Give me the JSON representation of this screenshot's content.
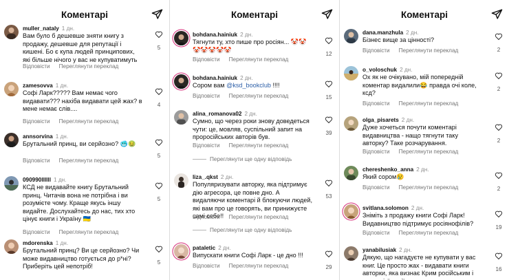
{
  "panels": [
    {
      "title": "Коментарі",
      "comments": [
        {
          "user": "muller_nataly",
          "time": "1 дн.",
          "text": "Вам було б дешевше зняти книгу з продажу, дешевше для репутації і кишені. Бо є купа людей принципових, які більше нічого у вас не купуватимуть",
          "reply": "Відповісти",
          "translate": "Переглянути переклад",
          "likes": "5"
        },
        {
          "user": "zamesovva",
          "time": "1 дн.",
          "text": "Софі Ларк????? Вам немає чого видавати??? нахіба видавати цей жах? в мене немає слів....",
          "reply": "Відповісти",
          "translate": "Переглянути переклад",
          "likes": "4"
        },
        {
          "user": "annsorvina",
          "time": "1 дн.",
          "text": "Брутальний принц, ви серйозно? 🥶🤢",
          "reply": "Відповісти",
          "translate": "Переглянути переклад",
          "likes": "5"
        },
        {
          "user": "090990llllll",
          "time": "1 дн.",
          "text": "КСД не видавайте книгу Брутальний принц. Читачів вона не потрібна і ви розумієте чому. Краще якусь іншу видайте. Дослухайтесь до нас, тих хто цінує книги і Україну 🇺🇦",
          "reply": "Відповісти",
          "translate": "Переглянути переклад",
          "likes": "5"
        },
        {
          "user": "mdorenska",
          "time": "1 дн.",
          "text": "Брутальний принц? Ви це серйозно? Чи може видавництво готується до р*ні? Приберіть цей непотріб!",
          "reply": "",
          "translate": "",
          "likes": "5"
        }
      ]
    },
    {
      "title": "Коментарі",
      "comments": [
        {
          "user": "bohdana.hainiuk",
          "time": "2 дн.",
          "text": "Тягнути ту, хто пише про росіян... 🤡🤡🤡🤡🤡🤡🤡",
          "reply": "Відповісти",
          "translate": "Переглянути переклад",
          "likes": "12"
        },
        {
          "user": "bohdana.hainiuk",
          "time": "2 дн.",
          "text_prefix": "Сором вам ",
          "mention": "@ksd_bookclub",
          "text_suffix": " !!!!",
          "reply": "Відповісти",
          "translate": "Переглянути переклад",
          "likes": "15"
        },
        {
          "user": "alina_romanova02",
          "time": "2 дн.",
          "text": "Сумно, що через роки знову доведеться чути: це, мовляв, суспільний запит на проросійських авторів був.",
          "reply": "Відповісти",
          "translate": "Переглянути переклад",
          "more": "Переглянути ще одну відповідь",
          "likes": "39"
        },
        {
          "user": "liza_.qkst",
          "time": "2 дн.",
          "text": "Популяризувати авторку, яка підтримує дію агресора, це повне дно. А видаляючи коментарі й блокуючи людей, які вам про це говорять, ви принижуєте самі себе!!",
          "reply": "Відповісти",
          "translate": "Переглянути переклад",
          "more": "Переглянути ще одну відповідь",
          "likes": "53"
        },
        {
          "user": "pataletic",
          "time": "2 дн.",
          "text": "Випускати книги Софі Ларк - це дно !!!",
          "reply": "Відповісти",
          "translate": "Переглянути переклад",
          "likes": "29"
        }
      ]
    },
    {
      "title": "Коментарі",
      "comments": [
        {
          "user": "dana.manzhula",
          "time": "2 дн.",
          "text": "Бізнес вище за цінності?",
          "reply": "Відповісти",
          "translate": "Переглянути переклад",
          "likes": "2"
        },
        {
          "user": "o_voloschuk",
          "time": "2 дн.",
          "text": "Ох як не очікувано, мій попередній коментар видалили😂 правда очі коле, ксд?",
          "reply": "Відповісти",
          "translate": "Переглянути переклад",
          "likes": "2"
        },
        {
          "user": "olga_pisarets",
          "time": "2 дн.",
          "text": "Дуже хочеться почути коментарі видавництва - нащо тягнути таку авторку? Таке розчарування.",
          "reply": "Відповісти",
          "translate": "Переглянути переклад",
          "likes": "2"
        },
        {
          "user": "chereshenko_anna",
          "time": "2 дн.",
          "text": "Який сором😢",
          "reply": "Відповісти",
          "translate": "Переглянути переклад",
          "likes": "2"
        },
        {
          "user": "svitlana.solomon",
          "time": "2 дн.",
          "text": "Зніміть з продажу книги Софі Ларк! Видавництво підтримує росіянофілів?",
          "reply": "Відповісти",
          "translate": "Переглянути переклад",
          "likes": "19"
        },
        {
          "user": "yanabilusiak",
          "time": "2 дн.",
          "text": "Дякую, що нагадуєте не купувати у вас книг. Це просто жах - видавати книги авторки, яка визнає Крим російським і пише цієї серії просто",
          "reply": "",
          "translate": "",
          "likes": "16"
        }
      ]
    }
  ],
  "colors": {
    "story_ring": "#d62976",
    "mention": "#2d5fa8"
  }
}
